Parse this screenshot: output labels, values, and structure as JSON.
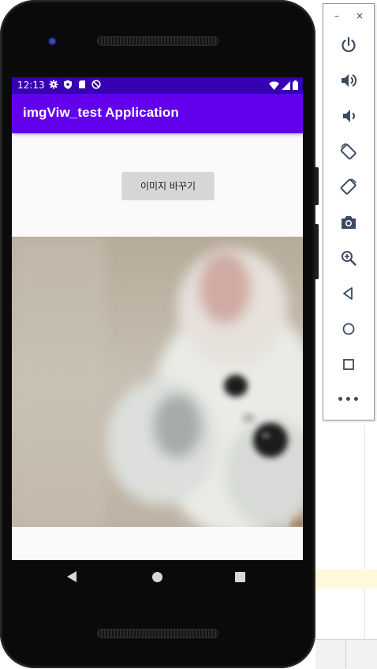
{
  "status_bar": {
    "time": "12:13",
    "icons_left": [
      "gear-icon",
      "shield-icon",
      "sd-card-icon",
      "no-sync-icon"
    ],
    "icons_right": [
      "wifi-icon",
      "signal-icon",
      "battery-icon"
    ]
  },
  "app": {
    "title": "imgViw_test Application",
    "button_label": "이미지 바꾸기",
    "image_subject": "blurred white puppy photo"
  },
  "nav_bar": {
    "buttons": [
      "back-icon",
      "home-icon",
      "recents-icon"
    ]
  },
  "emulator_panel": {
    "window_buttons": [
      "–",
      "×"
    ],
    "controls": [
      "power-icon",
      "volume-up-icon",
      "volume-down-icon",
      "rotate-left-icon",
      "rotate-right-icon",
      "camera-icon",
      "zoom-icon",
      "back-icon",
      "home-icon",
      "overview-icon",
      "more-icon"
    ],
    "more_label": "•••"
  },
  "colors": {
    "status_bar": "#3700b3",
    "app_bar": "#6200ee",
    "button": "#d6d6d6",
    "panel_icon": "#3c4a63"
  }
}
